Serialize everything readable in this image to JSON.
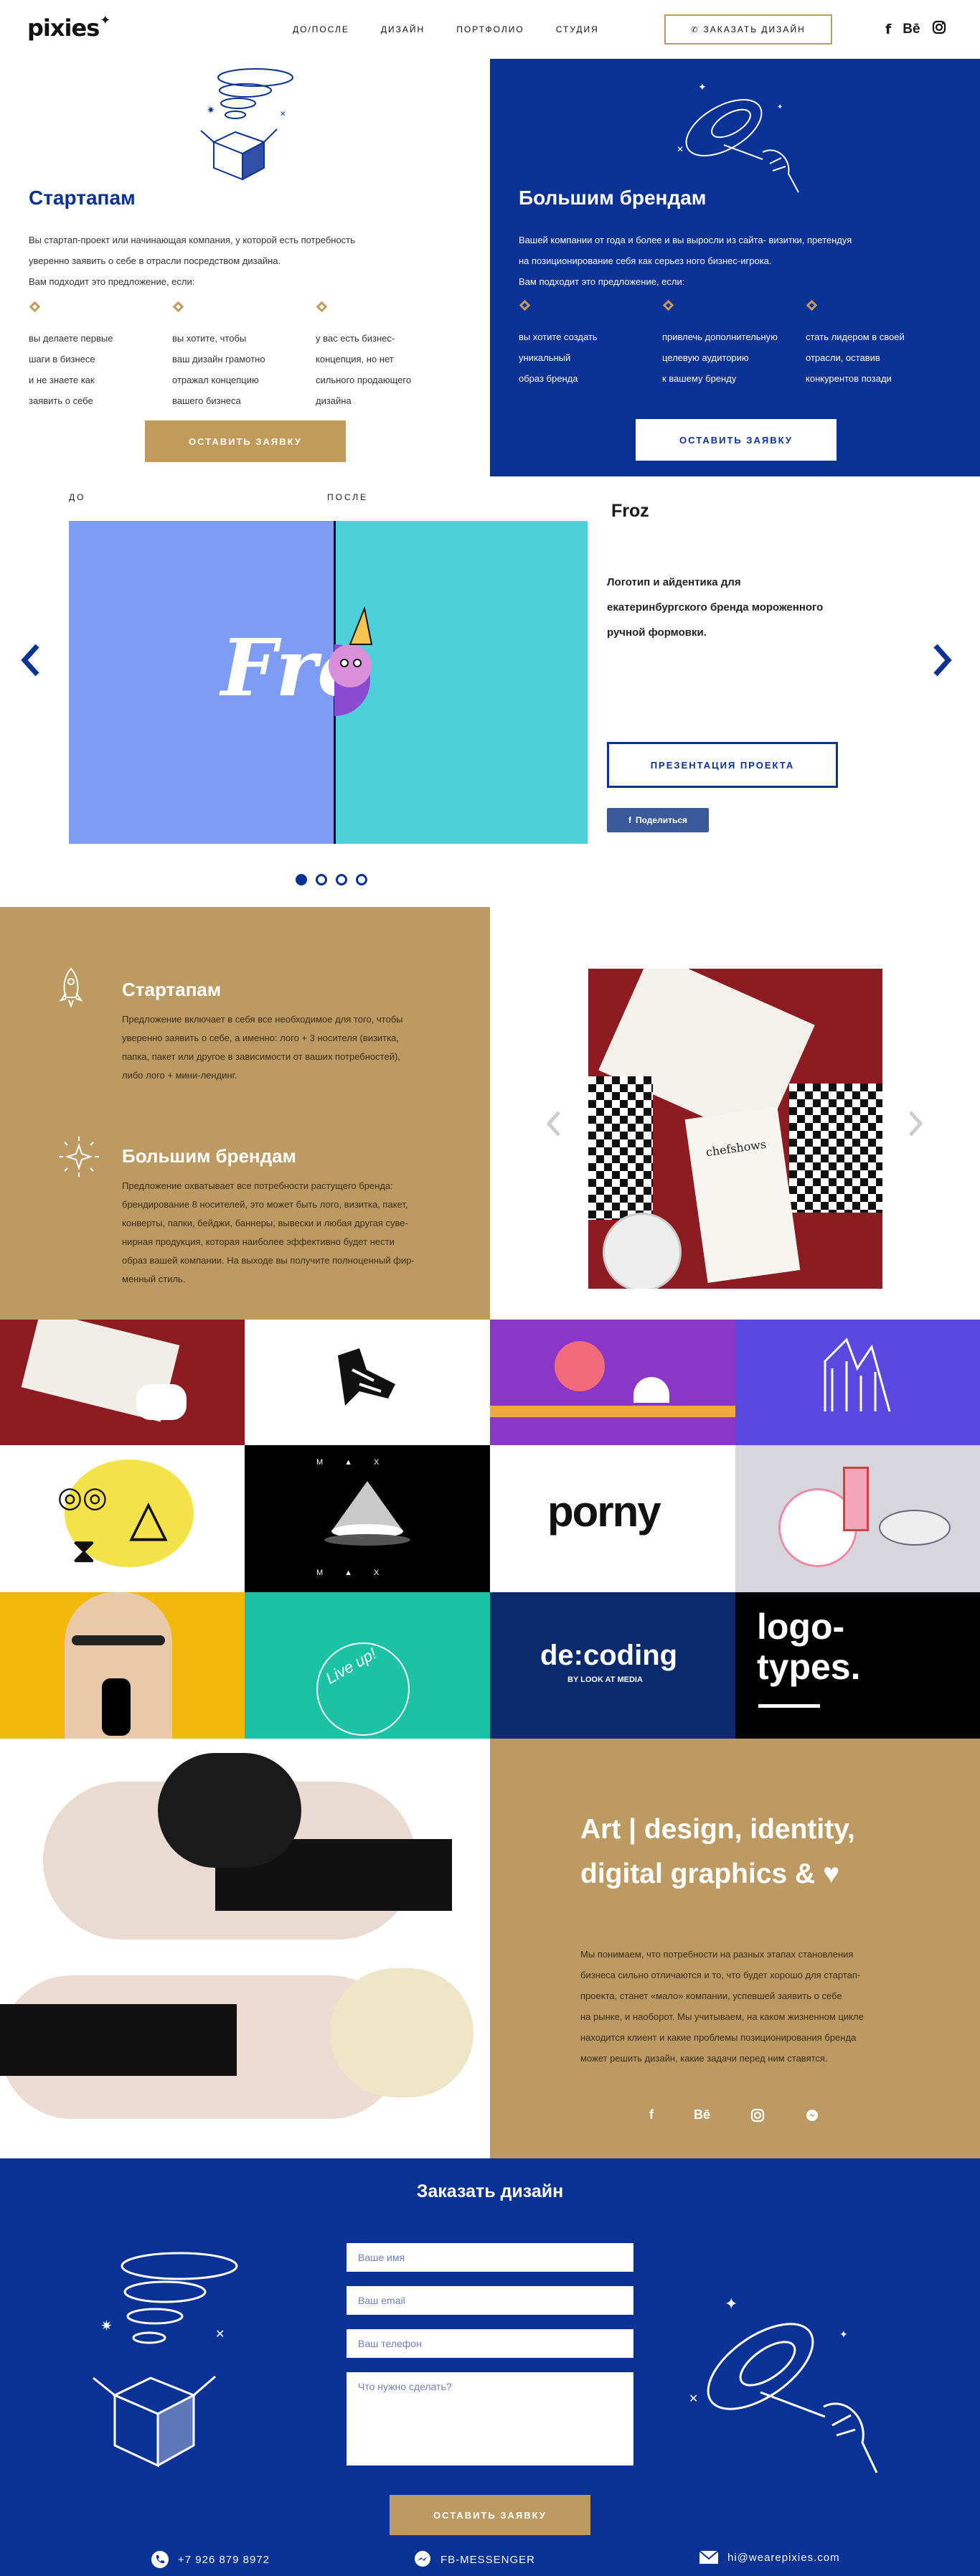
{
  "header": {
    "logo": "pixies",
    "nav": [
      "ДО/ПОСЛЕ",
      "ДИЗАЙН",
      "ПОРТФОЛИО",
      "СТУДИЯ"
    ],
    "order_button": "ЗАКАЗАТЬ ДИЗАЙН",
    "socials": [
      "facebook-icon",
      "behance-icon",
      "instagram-icon"
    ]
  },
  "startups": {
    "title": "Стартапам",
    "text_lines": [
      "Вы стартап-проект или начинающая компания, у которой есть потребность",
      "уверенно заявить о себе в отрасли посредством дизайна.",
      "Вам подходит это предложение, если:"
    ],
    "points": [
      [
        "вы делаете первые",
        "шаги в бизнесе",
        "и не знаете как",
        "заявить о себе"
      ],
      [
        "вы хотите, чтобы",
        "ваш дизайн грамотно",
        "отражал концепцию",
        "вашего бизнеса"
      ],
      [
        "у вас есть бизнес-",
        "концепция, но нет",
        "сильного продающего",
        "дизайна"
      ]
    ],
    "button": "ОСТАВИТЬ ЗАЯВКУ"
  },
  "brands": {
    "title": "Большим брендам",
    "text_lines": [
      "Вашей компании от года и более и вы выросли из сайта- визитки, претендуя",
      "на позиционирование себя как серьез ного бизнес-игрока.",
      "Вам подходит это предложение, если:"
    ],
    "points": [
      [
        "вы хотите создать",
        "уникальный",
        "образ бренда"
      ],
      [
        "привлечь дополнительную",
        "целевую аудиторию",
        "к вашему бренду"
      ],
      [
        "стать лидером в своей",
        "отрасли, оставив",
        "конкурентов позади"
      ]
    ],
    "button": "ОСТАВИТЬ ЗАЯВКУ"
  },
  "slider": {
    "before_label": "ДО",
    "after_label": "ПОСЛЕ",
    "slide_text": "Fro",
    "project_name": "Froz",
    "description_lines": [
      "Логотип и айдентика для",
      "екатеринбургского бренда мороженного",
      "ручной формовки."
    ],
    "present_button": "ПРЕЗЕНТАЦИЯ ПРОЕКТА",
    "share_button": "Поделиться",
    "slides_count": 4,
    "active_slide": 1,
    "colors": {
      "before_bg": "#7f9cf5",
      "after_bg": "#4dd0d9"
    }
  },
  "services": {
    "startups_title": "Стартапам",
    "startups_lines": [
      "Предложение включает в себя все необходимое для того, чтобы",
      "уверенно заявить о себе, а именно: лого + 3 носителя (визитка,",
      "папка, пакет или другое в зависимости от ваших потребностей),",
      "либо лого + мини-лендинг."
    ],
    "brands_title": "Большим брендам",
    "brands_lines": [
      "Предложение охватывает все потребности растущего бренда:",
      "брендирование 8 носителей, это может быть лого, визитка, пакет,",
      "конверты, папки, бейджи, баннеры, вывески и любая другая суве-",
      "нирная продукция, которая наиболее эффективно будет нести",
      "образ вашей компании. На выходе вы получите полноценный фир-",
      "менный стиль."
    ],
    "photo_text": "chefshows"
  },
  "grid": {
    "porny": "porny",
    "decoding": "de:coding",
    "decoding_sub": "BY LOOK AT MEDIA",
    "logotypes_1": "logo-",
    "logotypes_2": "types.",
    "liveup": "Live up!"
  },
  "art": {
    "title_1": "Art | design, identity,",
    "title_2": "digital graphics &",
    "text_lines": [
      "Мы понимаем, что потребности на разных этапах становления",
      "бизнеса сильно отличаются и то, что будет хорошо для стартап-",
      "проекта, станет «мало» компании, успевшей заявить о себе",
      "на рынке, и наоборот. Мы учитываем, на каком жизненном цикле",
      "находится клиент и какие проблемы позиционирования бренда",
      "может решить дизайн, какие задачи перед ним ставятся."
    ],
    "socials": [
      "f",
      "Bē"
    ]
  },
  "order": {
    "title": "Заказать дизайн",
    "name_placeholder": "Ваше имя",
    "email_placeholder": "Ваш email",
    "phone_placeholder": "Ваш телефон",
    "message_placeholder": "Что нужно сделать?",
    "submit": "ОСТАВИТЬ ЗАЯВКУ",
    "phone": "+7 926 879 8972",
    "messenger": "FB-MESSENGER",
    "email": "hi@wearepixies.com"
  }
}
